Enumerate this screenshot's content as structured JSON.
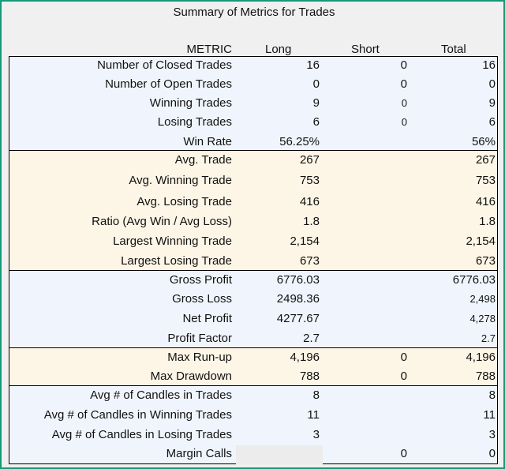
{
  "title": "Summary of Metrics for Trades",
  "headers": {
    "metric": "METRIC",
    "long": "Long",
    "short": "Short",
    "total": "Total"
  },
  "colors": {
    "frame_border": "#159a78",
    "background": "#f0f0f0",
    "group_blue": "#f0f5fd",
    "group_beige": "#fdf5e6",
    "empty_cell": "#ececec"
  },
  "groups": [
    {
      "theme": "blue",
      "rows": [
        {
          "metric": "Number of Closed Trades",
          "long": "16",
          "short": "0",
          "total": "16"
        },
        {
          "metric": "Number of Open Trades",
          "long": "0",
          "short": "0",
          "total": "0"
        },
        {
          "metric": "Winning Trades",
          "long": "9",
          "short": "0",
          "total": "9"
        },
        {
          "metric": "Losing Trades",
          "long": "6",
          "short": "0",
          "total": "6"
        },
        {
          "metric": "Win Rate",
          "long": "56.25%",
          "short": "",
          "total": "56%"
        }
      ]
    },
    {
      "theme": "beige",
      "rows": [
        {
          "metric": "Avg. Trade",
          "long": "267",
          "short": "",
          "total": "267"
        },
        {
          "metric": "Avg. Winning Trade",
          "long": "753",
          "short": "",
          "total": "753"
        },
        {
          "metric": "Avg. Losing Trade",
          "long": "416",
          "short": "",
          "total": "416"
        },
        {
          "metric": "Ratio (Avg Win / Avg Loss)",
          "long": "1.8",
          "short": "",
          "total": "1.8"
        },
        {
          "metric": "Largest Winning Trade",
          "long": "2,154",
          "short": "",
          "total": "2,154"
        },
        {
          "metric": "Largest Losing Trade",
          "long": "673",
          "short": "",
          "total": "673"
        }
      ]
    },
    {
      "theme": "blue",
      "rows": [
        {
          "metric": "Gross Profit",
          "long": "6776.03",
          "short": "",
          "total": "6776.03"
        },
        {
          "metric": "Gross Loss",
          "long": "2498.36",
          "short": "",
          "total": "2,498"
        },
        {
          "metric": "Net Profit",
          "long": "4277.67",
          "short": "",
          "total": "4,278"
        },
        {
          "metric": "Profit Factor",
          "long": "2.7",
          "short": "",
          "total": "2.7"
        }
      ]
    },
    {
      "theme": "beige",
      "rows": [
        {
          "metric": "Max Run-up",
          "long": "4,196",
          "short": "0",
          "total": "4,196"
        },
        {
          "metric": "Max Drawdown",
          "long": "788",
          "short": "0",
          "total": "788"
        }
      ]
    },
    {
      "theme": "blue",
      "rows": [
        {
          "metric": "Avg # of Candles in Trades",
          "long": "8",
          "short": "",
          "total": "8"
        },
        {
          "metric": "Avg # of Candles in Winning Trades",
          "long": "11",
          "short": "",
          "total": "11"
        },
        {
          "metric": "Avg # of Candles in Losing Trades",
          "long": "3",
          "short": "",
          "total": "3"
        },
        {
          "metric": "Margin Calls",
          "long": "",
          "short": "0",
          "total": "0"
        }
      ]
    }
  ]
}
